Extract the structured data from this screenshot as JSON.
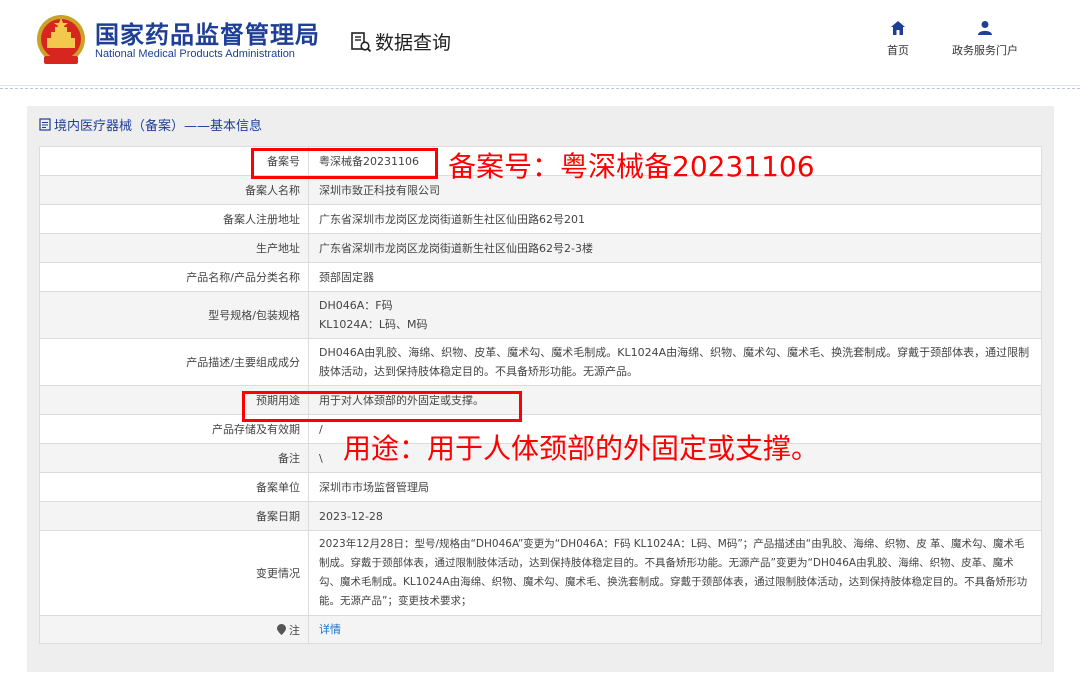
{
  "header": {
    "org_title": "国家药品监督管理局",
    "org_subtitle": "National Medical Products Administration",
    "data_query": "数据查询",
    "nav": [
      {
        "label": "首页",
        "icon": "home-icon"
      },
      {
        "label": "政务服务门户",
        "icon": "user-icon"
      }
    ]
  },
  "panel": {
    "title": "境内医疗器械（备案）——基本信息"
  },
  "rows": [
    {
      "label": "备案号",
      "value": "粤深械备20231106"
    },
    {
      "label": "备案人名称",
      "value": "深圳市致正科技有限公司"
    },
    {
      "label": "备案人注册地址",
      "value": "广东省深圳市龙岗区龙岗街道新生社区仙田路62号201"
    },
    {
      "label": "生产地址",
      "value": "广东省深圳市龙岗区龙岗街道新生社区仙田路62号2-3楼"
    },
    {
      "label": "产品名称/产品分类名称",
      "value": "颈部固定器"
    },
    {
      "label": "型号规格/包装规格",
      "value": "DH046A：F码\nKL1024A：L码、M码"
    },
    {
      "label": "产品描述/主要组成成分",
      "value": "DH046A由乳胶、海绵、织物、皮革、魔术勾、魔术毛制成。KL1024A由海绵、织物、魔术勾、魔术毛、换洗套制成。穿戴于颈部体表，通过限制肢体活动，达到保持肢体稳定目的。不具备矫形功能。无源产品。"
    },
    {
      "label": "预期用途",
      "value": "用于对人体颈部的外固定或支撑。"
    },
    {
      "label": "产品存储及有效期",
      "value": "/"
    },
    {
      "label": "备注",
      "value": "\\"
    },
    {
      "label": "备案单位",
      "value": "深圳市市场监督管理局"
    },
    {
      "label": "备案日期",
      "value": "2023-12-28"
    },
    {
      "label": "变更情况",
      "value": "2023年12月28日：型号/规格由“DH046A”变更为“DH046A：F码 KL1024A：L码、M码”；产品描述由“由乳胶、海绵、织物、皮 革、魔术勾、魔术毛制成。穿戴于颈部体表，通过限制肢体活动，达到保持肢体稳定目的。不具备矫形功能。无源产品”变更为“DH046A由乳胶、海绵、织物、皮革、魔术勾、魔术毛制成。KL1024A由海绵、织物、魔术勾、魔术毛、换洗套制成。穿戴于颈部体表，通过限制肢体活动，达到保持肢体稳定目的。不具备矫形功能。无源产品”；变更技术要求；"
    },
    {
      "label": "注",
      "value": "详情"
    }
  ],
  "annotations": {
    "record_no": "备案号：粤深械备20231106",
    "usage": "用途：用于人体颈部的外固定或支撑。"
  },
  "colors": {
    "brand_blue": "#1e3f95",
    "annotation_red": "#ff0000",
    "link_blue": "#1e6fc7"
  }
}
